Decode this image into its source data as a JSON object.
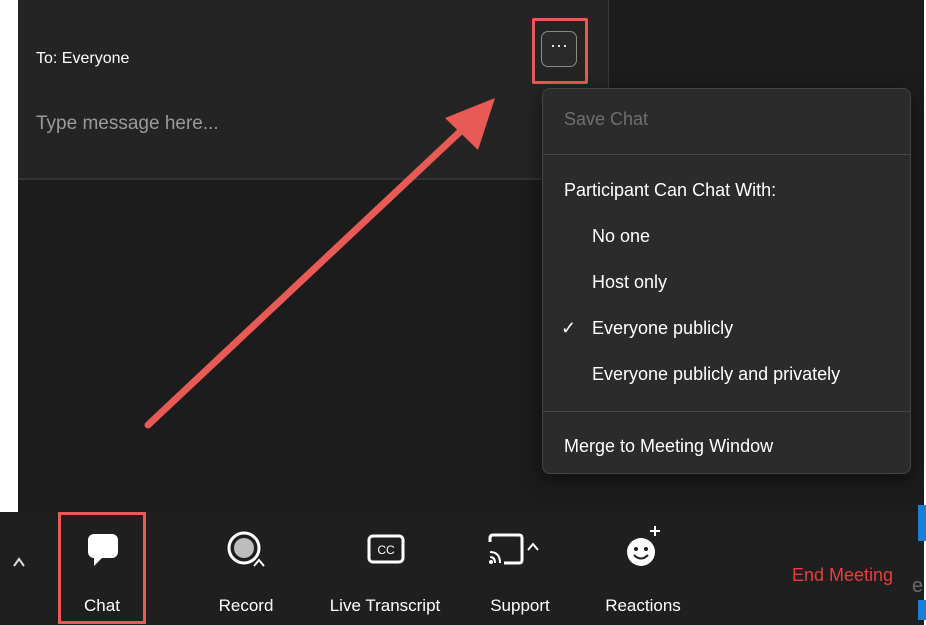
{
  "chat": {
    "recipient": "To: Everyone",
    "placeholder": "Type message here...",
    "more_glyph": "···"
  },
  "menu": {
    "save_chat": "Save Chat",
    "section_header": "Participant Can Chat With:",
    "options": [
      {
        "label": "No one",
        "checked": false
      },
      {
        "label": "Host only",
        "checked": false
      },
      {
        "label": "Everyone publicly",
        "checked": true
      },
      {
        "label": "Everyone publicly and privately",
        "checked": false
      }
    ],
    "check_glyph": "✓",
    "merge": "Merge to Meeting Window"
  },
  "toolbar": {
    "items": [
      {
        "label": "Chat",
        "icon": "chat-bubble-icon"
      },
      {
        "label": "Record",
        "icon": "record-icon"
      },
      {
        "label": "Live Transcript",
        "icon": "cc-icon"
      },
      {
        "label": "Support",
        "icon": "screen-cast-icon"
      },
      {
        "label": "Reactions",
        "icon": "emoji-add-icon"
      }
    ],
    "cc_text": "CC",
    "end_meeting": "End Meeting"
  },
  "fragments": {
    "right_edge": "e"
  },
  "colors": {
    "highlight": "#e85a55",
    "end_meeting": "#ec3d3d",
    "background": "#1c1c1c"
  }
}
